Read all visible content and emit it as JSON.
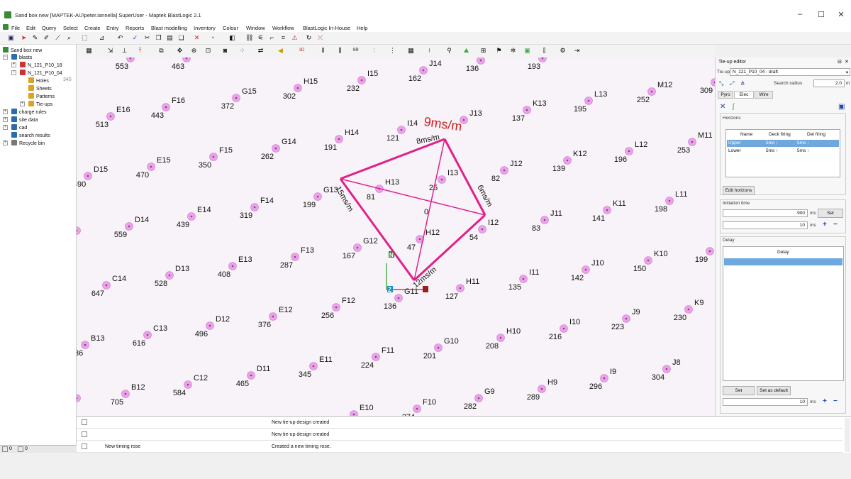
{
  "window": {
    "title": "Sand box new [MAPTEK-AU\\peter.iannella] SuperUser - Maptek BlastLogic 2.1"
  },
  "menu": [
    "File",
    "Edit",
    "Query",
    "Select",
    "Create",
    "Entry",
    "Reports",
    "Blast modelling",
    "Inventory",
    "Colour",
    "Window",
    "Workflow",
    "BlastLogic In-House",
    "Help"
  ],
  "tree": {
    "root": "Sand box new",
    "blasts": "blasts",
    "blast1": "N_121_P10_18",
    "blast2": "N_121_P10_04",
    "holes": "Holes",
    "holes_count": "340",
    "sheets": "Sheets",
    "patterns": "Patterns",
    "tieups": "Tie-ups",
    "charge_rules": "charge rules",
    "site_data": "site data",
    "cad": "cad",
    "search_results": "search results",
    "recycle_bin": "Recycle bin",
    "status_left": "0",
    "status_right": "0"
  },
  "viewport": {
    "timing_label_big": "9ms/m",
    "rose_labels": {
      "top": "8ms/m",
      "left": "15ms/m",
      "right": "6ms/m",
      "bottom": "12ms/m",
      "center": "0"
    },
    "axis": {
      "n": "N",
      "z": "Z",
      "e": "E"
    },
    "holes": [
      {
        "id": "E17",
        "t": "553"
      },
      {
        "id": "",
        "t": "463"
      },
      {
        "id": "",
        "t": ""
      },
      {
        "id": "I15",
        "t": "232"
      },
      {
        "id": "J14",
        "t": "162"
      },
      {
        "id": "",
        "t": "136"
      },
      {
        "id": "",
        "t": "193"
      },
      {
        "id": "E16",
        "t": "513"
      },
      {
        "id": "F16",
        "t": "443"
      },
      {
        "id": "G15",
        "t": "372"
      },
      {
        "id": "H15",
        "t": "302"
      },
      {
        "id": "I14",
        "t": "121"
      },
      {
        "id": "J13",
        "t": ""
      },
      {
        "id": "K13",
        "t": "137"
      },
      {
        "id": "L13",
        "t": "195"
      },
      {
        "id": "M12",
        "t": "252"
      },
      {
        "id": "",
        "t": "309"
      },
      {
        "id": "D15",
        "t": "590"
      },
      {
        "id": "E15",
        "t": "470"
      },
      {
        "id": "F15",
        "t": "350"
      },
      {
        "id": "G14",
        "t": "262"
      },
      {
        "id": "H14",
        "t": "191"
      },
      {
        "id": "I13",
        "t": "25"
      },
      {
        "id": "J12",
        "t": "82"
      },
      {
        "id": "K12",
        "t": "139"
      },
      {
        "id": "L12",
        "t": "196"
      },
      {
        "id": "M11",
        "t": "253"
      },
      {
        "id": "D14",
        "t": "559"
      },
      {
        "id": "E14",
        "t": "439"
      },
      {
        "id": "F14",
        "t": "319"
      },
      {
        "id": "G13",
        "t": "199"
      },
      {
        "id": "H13",
        "t": "81"
      },
      {
        "id": "I12",
        "t": "54"
      },
      {
        "id": "J11",
        "t": "83"
      },
      {
        "id": "K11",
        "t": "141"
      },
      {
        "id": "L11",
        "t": "198"
      },
      {
        "id": "C14",
        "t": "647"
      },
      {
        "id": "D13",
        "t": "528"
      },
      {
        "id": "E13",
        "t": "408"
      },
      {
        "id": "F13",
        "t": "287"
      },
      {
        "id": "G12",
        "t": "167"
      },
      {
        "id": "H12",
        "t": "47"
      },
      {
        "id": "I11",
        "t": "135"
      },
      {
        "id": "J10",
        "t": "142"
      },
      {
        "id": "K10",
        "t": "150"
      },
      {
        "id": "",
        "t": "199"
      },
      {
        "id": "B13",
        "t": "736"
      },
      {
        "id": "C13",
        "t": "616"
      },
      {
        "id": "D12",
        "t": "496"
      },
      {
        "id": "E12",
        "t": "376"
      },
      {
        "id": "F12",
        "t": "256"
      },
      {
        "id": "G11",
        "t": "136"
      },
      {
        "id": "H11",
        "t": "127"
      },
      {
        "id": "I10",
        "t": "216"
      },
      {
        "id": "J9",
        "t": "223"
      },
      {
        "id": "K9",
        "t": "230"
      },
      {
        "id": "B12",
        "t": "705"
      },
      {
        "id": "C12",
        "t": "584"
      },
      {
        "id": "D11",
        "t": "465"
      },
      {
        "id": "E11",
        "t": "345"
      },
      {
        "id": "F11",
        "t": "224"
      },
      {
        "id": "G10",
        "t": "201"
      },
      {
        "id": "H10",
        "t": "208"
      },
      {
        "id": "I9",
        "t": "296"
      },
      {
        "id": "J8",
        "t": "304"
      },
      {
        "id": "H9",
        "t": "289"
      },
      {
        "id": "G9",
        "t": "282"
      },
      {
        "id": "E10",
        "t": ""
      },
      {
        "id": "F10",
        "t": "274"
      },
      {
        "id": "",
        "t": "15"
      },
      {
        "id": "",
        "t": "12"
      }
    ]
  },
  "log": [
    {
      "name": "",
      "msg": "New tie-up design created"
    },
    {
      "name": "",
      "msg": "New tie-up design created"
    },
    {
      "name": "New timing rose",
      "msg": "Created a new timing rose."
    }
  ],
  "tieup_editor": {
    "title": "Tie-up editor",
    "tieup_label": "Tie-up",
    "tieup_value": "N_121_P10_04 - draft",
    "search_label": "Search radius",
    "search_value": "2.0",
    "search_unit": "m",
    "tabs": [
      "Pyro",
      "Elec",
      "Wire"
    ],
    "horizons_label": "Horizons",
    "columns": [
      "Name",
      "Deck firing",
      "Det firing"
    ],
    "rows": [
      {
        "name": "Upper",
        "deck": "5ms ↑",
        "det": "5ms ↑"
      },
      {
        "name": "Lower",
        "deck": "5ms ↑",
        "det": "5ms ↑"
      }
    ],
    "edit_horizons": "Edit horizons",
    "initiation_label": "Initiation time",
    "initiation_value": "900",
    "initiation_unit": "ms",
    "set_label": "Set",
    "step_value": "10",
    "step_unit": "ms",
    "delay_label": "Delay",
    "delay_col": "Delay",
    "set2_label": "Set",
    "set_default_label": "Set as default",
    "delay_step_value": "10",
    "delay_step_unit": "ms",
    "unit_m": "m"
  }
}
